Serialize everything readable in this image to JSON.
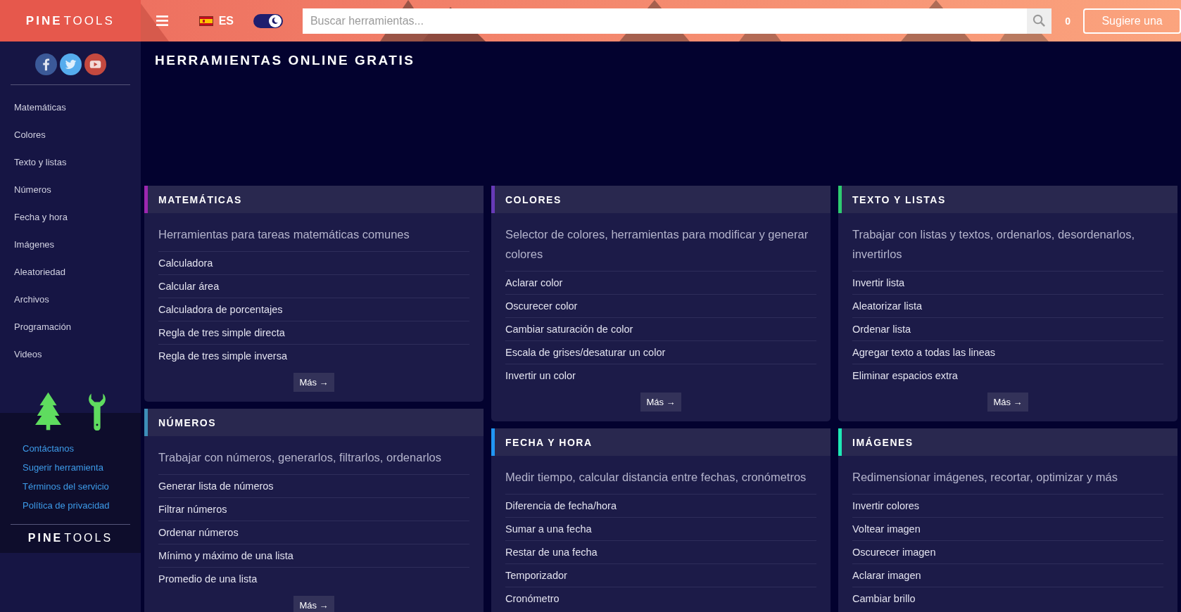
{
  "header": {
    "logo": {
      "bold": "PINE",
      "light": "TOOLS"
    },
    "language": "ES",
    "dark_mode": {
      "on": true
    },
    "search": {
      "placeholder": "Buscar herramientas..."
    },
    "counter": "0",
    "suggest_button": "Sugiere una"
  },
  "sidebar": {
    "items": [
      "Matemáticas",
      "Colores",
      "Texto y listas",
      "Números",
      "Fecha y hora",
      "Imágenes",
      "Aleatoriedad",
      "Archivos",
      "Programación",
      "Videos"
    ],
    "footer_links": [
      "Contáctanos",
      "Sugerir herramienta",
      "Términos del servicio",
      "Política de privacidad"
    ],
    "footer_logo": {
      "bold": "PINE",
      "light": "TOOLS"
    }
  },
  "main": {
    "title": "HERRAMIENTAS ONLINE GRATIS",
    "columns": [
      [
        {
          "title": "MATEMÁTICAS",
          "color": "#9c27b0",
          "description": "Herramientas para tareas matemáticas comunes",
          "links": [
            "Calculadora",
            "Calcular área",
            "Calculadora de porcentajes",
            "Regla de tres simple directa",
            "Regla de tres simple inversa"
          ],
          "more": "Más →"
        },
        {
          "title": "NÚMEROS",
          "color": "#3d8eb9",
          "description": "Trabajar con números, generarlos, filtrarlos, ordenarlos",
          "links": [
            "Generar lista de números",
            "Filtrar números",
            "Ordenar números",
            "Mínimo y máximo de una lista",
            "Promedio de una lista"
          ],
          "more": "Más →"
        }
      ],
      [
        {
          "title": "COLORES",
          "color": "#673ab7",
          "description": "Selector de colores, herramientas para modificar y generar colores",
          "links": [
            "Aclarar color",
            "Oscurecer color",
            "Cambiar saturación de color",
            "Escala de grises/desaturar un color",
            "Invertir un color"
          ],
          "more": "Más →"
        },
        {
          "title": "FECHA Y HORA",
          "color": "#2196f3",
          "description": "Medir tiempo, calcular distancia entre fechas, cronómetros",
          "links": [
            "Diferencia de fecha/hora",
            "Sumar a una fecha",
            "Restar de una fecha",
            "Temporizador",
            "Cronómetro"
          ]
        }
      ],
      [
        {
          "title": "TEXTO Y LISTAS",
          "color": "#2ecc71",
          "description": "Trabajar con listas y textos, ordenarlos, desordenarlos, invertirlos",
          "links": [
            "Invertir lista",
            "Aleatorizar lista",
            "Ordenar lista",
            "Agregar texto a todas las lineas",
            "Eliminar espacios extra"
          ],
          "more": "Más →"
        },
        {
          "title": "IMÁGENES",
          "color": "#1de9b6",
          "description": "Redimensionar imágenes, recortar, optimizar y más",
          "links": [
            "Invertir colores",
            "Voltear imagen",
            "Oscurecer imagen",
            "Aclarar imagen",
            "Cambiar brillo"
          ]
        }
      ]
    ]
  }
}
